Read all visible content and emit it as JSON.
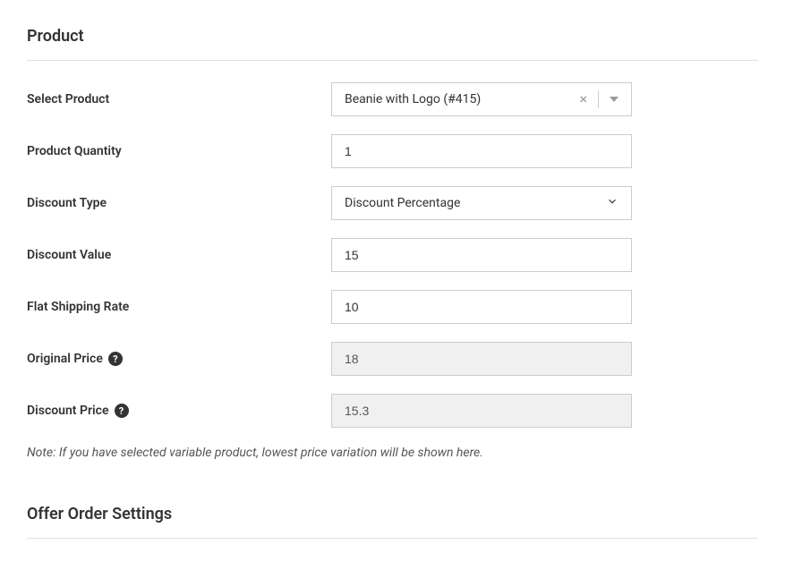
{
  "section1": {
    "title": "Product"
  },
  "fields": {
    "selectProduct": {
      "label": "Select Product",
      "value": "Beanie with Logo (#415)"
    },
    "productQuantity": {
      "label": "Product Quantity",
      "value": "1"
    },
    "discountType": {
      "label": "Discount Type",
      "value": "Discount Percentage"
    },
    "discountValue": {
      "label": "Discount Value",
      "value": "15"
    },
    "flatShippingRate": {
      "label": "Flat Shipping Rate",
      "value": "10"
    },
    "originalPrice": {
      "label": "Original Price",
      "value": "18"
    },
    "discountPrice": {
      "label": "Discount Price",
      "value": "15.3"
    }
  },
  "note": "Note: If you have selected variable product, lowest price variation will be shown here.",
  "section2": {
    "title": "Offer Order Settings"
  },
  "helpGlyph": "?"
}
